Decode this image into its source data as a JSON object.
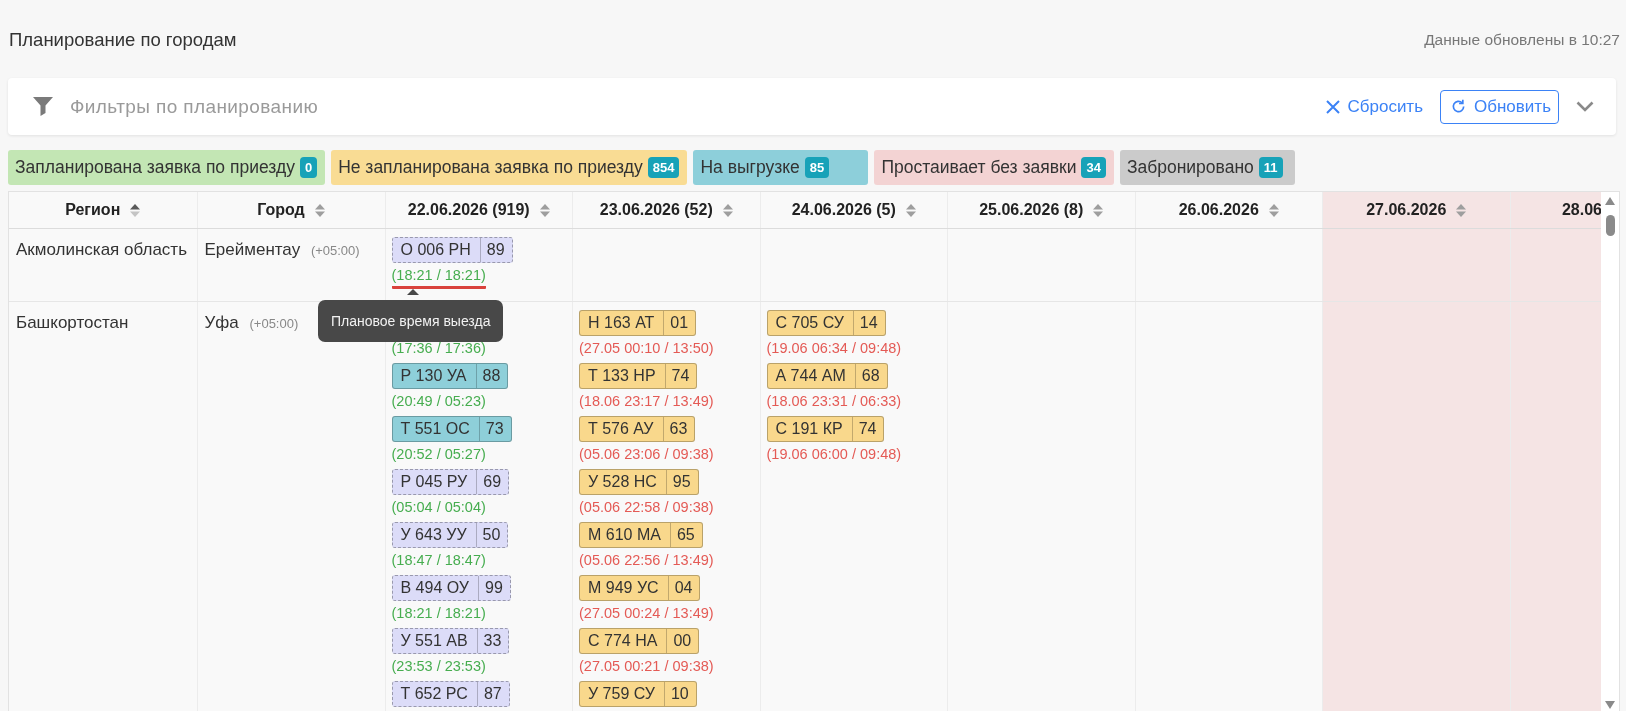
{
  "page": {
    "title": "Планирование по городам",
    "updated": "Данные обновлены в 10:27"
  },
  "filter_bar": {
    "placeholder": "Фильтры по планированию",
    "reset_button": {
      "label": "Сбросить"
    },
    "refresh_button": {
      "label": "Обновить"
    }
  },
  "legend": [
    {
      "label": "Запланирована заявка по приезду",
      "count": "0",
      "color": "#c3e6b4"
    },
    {
      "label": "Не запланирована заявка по приезду",
      "count": "854",
      "color": "#f9dc94"
    },
    {
      "label": "На выгрузке",
      "count": "85",
      "color": "#8dcfda"
    },
    {
      "label": "Простаивает без заявки",
      "count": "34",
      "color": "#f3d3d3"
    },
    {
      "label": "Забронировано",
      "count": "11",
      "color": "#cbcbcb"
    }
  ],
  "table": {
    "columns": [
      {
        "label": "Регион",
        "sorted": true,
        "highlighted": false
      },
      {
        "label": "Город",
        "sorted": false,
        "highlighted": false
      },
      {
        "label": "22.06.2026 (919)",
        "sorted": false,
        "highlighted": false
      },
      {
        "label": "23.06.2026 (52)",
        "sorted": false,
        "highlighted": false
      },
      {
        "label": "24.06.2026 (5)",
        "sorted": false,
        "highlighted": false
      },
      {
        "label": "25.06.2026 (8)",
        "sorted": false,
        "highlighted": false
      },
      {
        "label": "26.06.2026",
        "sorted": false,
        "highlighted": false
      },
      {
        "label": "27.06.2026",
        "sorted": false,
        "highlighted": true
      },
      {
        "label": "28.06",
        "highlighted": true
      }
    ],
    "rows": [
      {
        "region": "Акмолинская область",
        "city": "Ерейментау",
        "offset": "(+05:00)",
        "days": [
          {
            "vehicles": [
              {
                "plate": "О 006 РН",
                "region_code": "89",
                "color": "#dcdcf8",
                "dashed": true,
                "time": {
                  "text": "(18:21 / 18:21)",
                  "color": "#46ad4f",
                  "underlined": true
                }
              }
            ]
          }
        ]
      },
      {
        "region": "Башкортостан",
        "city": "Уфа",
        "offset": "(+05:00)",
        "days": [
          {
            "vehicles": [
              {
                "time": {
                  "text": "(17:36 / 17:36)",
                  "color": "#46ad4f",
                  "underlined": false
                }
              },
              {
                "plate": "Р 130 УА",
                "region_code": "88",
                "color": "#8ecfd9",
                "dashed": false,
                "time": {
                  "text": "(20:49 / 05:23)",
                  "color": "#46ad4f",
                  "underlined": false
                }
              },
              {
                "plate": "Т 551 ОС",
                "region_code": "73",
                "color": "#8ecfd9",
                "dashed": false,
                "time": {
                  "text": "(20:52 / 05:27)",
                  "color": "#46ad4f",
                  "underlined": false
                }
              },
              {
                "plate": "Р 045 РУ",
                "region_code": "69",
                "color": "#dcdcf8",
                "dashed": true,
                "time": {
                  "text": "(05:04 / 05:04)",
                  "color": "#46ad4f",
                  "underlined": false
                }
              },
              {
                "plate": "У 643 УУ",
                "region_code": "50",
                "color": "#dcdcf8",
                "dashed": true,
                "time": {
                  "text": "(18:47 / 18:47)",
                  "color": "#46ad4f",
                  "underlined": false
                }
              },
              {
                "plate": "В 494 ОУ",
                "region_code": "99",
                "color": "#dcdcf8",
                "dashed": true,
                "time": {
                  "text": "(18:21 / 18:21)",
                  "color": "#46ad4f",
                  "underlined": false
                }
              },
              {
                "plate": "У 551 АВ",
                "region_code": "33",
                "color": "#dcdcf8",
                "dashed": true,
                "time": {
                  "text": "(23:53 / 23:53)",
                  "color": "#46ad4f",
                  "underlined": false
                }
              },
              {
                "plate": "Т 652 РС",
                "region_code": "87",
                "color": "#dcdcf8",
                "dashed": true
              }
            ]
          },
          {
            "vehicles": [
              {
                "plate": "Н 163 АТ",
                "region_code": "01",
                "color": "#f9d88c",
                "dashed": false,
                "time": {
                  "text": "(27.05 00:10 / 13:50)",
                  "color": "#e45a55",
                  "underlined": false
                }
              },
              {
                "plate": "Т 133 НР",
                "region_code": "74",
                "color": "#f9d88c",
                "dashed": false,
                "time": {
                  "text": "(18.06 23:17 / 13:49)",
                  "color": "#e45a55",
                  "underlined": false
                }
              },
              {
                "plate": "Т 576 АУ",
                "region_code": "63",
                "color": "#f9d88c",
                "dashed": false,
                "time": {
                  "text": "(05.06 23:06 / 09:38)",
                  "color": "#e45a55",
                  "underlined": false
                }
              },
              {
                "plate": "У 528 НС",
                "region_code": "95",
                "color": "#f9d88c",
                "dashed": false,
                "time": {
                  "text": "(05.06 22:58 / 09:38)",
                  "color": "#e45a55",
                  "underlined": false
                }
              },
              {
                "plate": "М 610 МА",
                "region_code": "65",
                "color": "#f9d88c",
                "dashed": false,
                "time": {
                  "text": "(05.06 22:56 / 13:49)",
                  "color": "#e45a55",
                  "underlined": false
                }
              },
              {
                "plate": "М 949 УС",
                "region_code": "04",
                "color": "#f9d88c",
                "dashed": false,
                "time": {
                  "text": "(27.05 00:24 / 13:49)",
                  "color": "#e45a55",
                  "underlined": false
                }
              },
              {
                "plate": "С 774 НА",
                "region_code": "00",
                "color": "#f9d88c",
                "dashed": false,
                "time": {
                  "text": "(27.05 00:21 / 09:38)",
                  "color": "#e45a55",
                  "underlined": false
                }
              },
              {
                "plate": "У 759 СУ",
                "region_code": "10",
                "color": "#f9d88c",
                "dashed": false
              }
            ]
          },
          {
            "vehicles": [
              {
                "plate": "С 705 СУ",
                "region_code": "14",
                "color": "#f9d88c",
                "dashed": false,
                "time": {
                  "text": "(19.06 06:34 / 09:48)",
                  "color": "#e45a55",
                  "underlined": false
                }
              },
              {
                "plate": "А 744 АМ",
                "region_code": "68",
                "color": "#f9d88c",
                "dashed": false,
                "time": {
                  "text": "(18.06 23:31 / 06:33)",
                  "color": "#e45a55",
                  "underlined": false
                }
              },
              {
                "plate": "С 191 КР",
                "region_code": "74",
                "color": "#f9d88c",
                "dashed": false,
                "time": {
                  "text": "(19.06 06:00 / 09:48)",
                  "color": "#e45a55",
                  "underlined": false
                }
              }
            ]
          }
        ]
      }
    ]
  },
  "tooltip": {
    "text": "Плановое время выезда"
  }
}
